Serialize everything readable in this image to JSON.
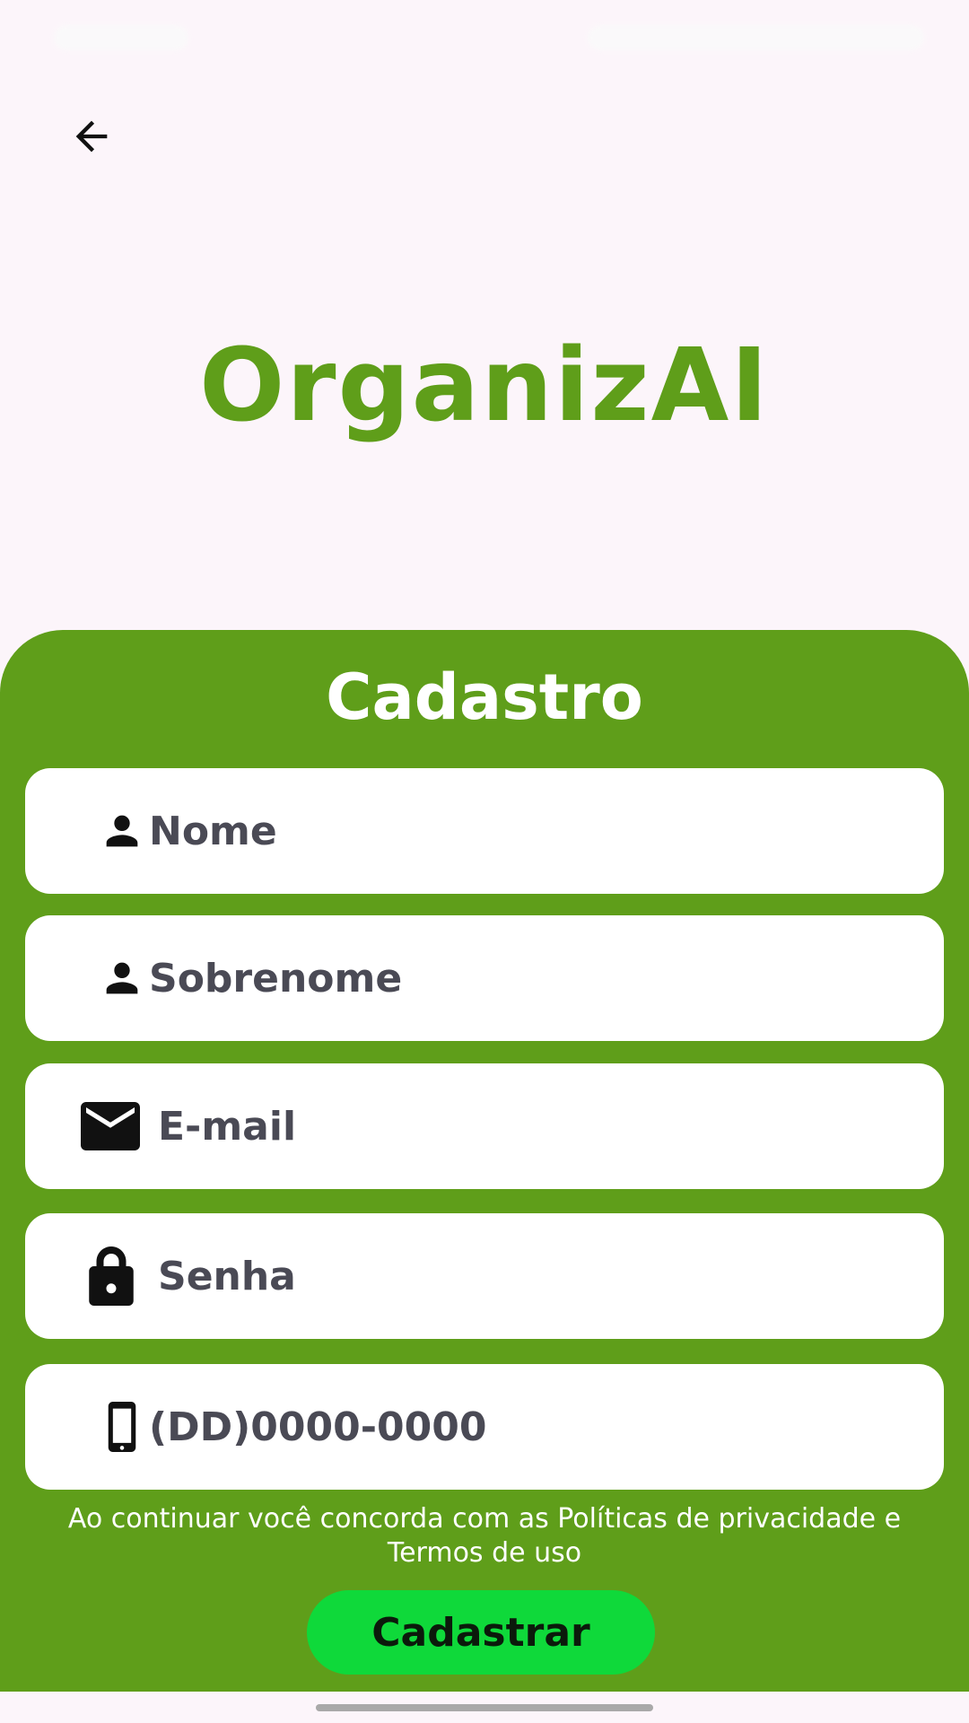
{
  "app": {
    "title": "OrganizAI",
    "brand_color": "#5f9e1a"
  },
  "nav": {
    "back_icon": "arrow-left-icon"
  },
  "form": {
    "title": "Cadastro",
    "fields": [
      {
        "icon": "person-icon",
        "placeholder": "Nome"
      },
      {
        "icon": "person-icon",
        "placeholder": "Sobrenome"
      },
      {
        "icon": "mail-icon",
        "placeholder": "E-mail"
      },
      {
        "icon": "lock-icon",
        "placeholder": "Senha"
      },
      {
        "icon": "phone-icon",
        "placeholder": "(DD)0000-0000"
      }
    ],
    "terms_line1": "Ao continuar você concorda com as Políticas de privacidade e",
    "terms_line2": "Termos de uso",
    "submit_label": "Cadastrar",
    "submit_color": "#0fd93a"
  }
}
